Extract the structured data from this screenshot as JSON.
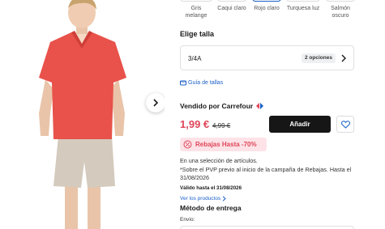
{
  "colors": {
    "accent": "#1a5fc7",
    "price": "#e0455a",
    "sale_bg": "#fde3e7",
    "button": "#161616",
    "shirt": "#e8524a",
    "shorts": "#d4cabd"
  },
  "swatches": [
    {
      "label": "Gris melange",
      "selected": false
    },
    {
      "label": "Caqui claro",
      "selected": false
    },
    {
      "label": "Rojo claro",
      "selected": true
    },
    {
      "label": "Turquesa luz",
      "selected": false
    },
    {
      "label": "Salmón oscuro",
      "selected": false
    }
  ],
  "size": {
    "title": "Elige talla",
    "value": "3/4A",
    "options_badge": "2 opciones"
  },
  "size_guide": "Guía de tallas",
  "seller": "Vendido por Carrefour",
  "price": {
    "current": "1,99 €",
    "old": "4,99 €"
  },
  "add_label": "Añadir",
  "sale_badge": "Rebajas Hasta -70%",
  "promo": {
    "line1": "En una selección de artículos.",
    "line2": "*Sobre el PVP previo al inicio de la campaña de Rebajas. Hasta el 31/08/2026",
    "valid": "Válido hasta el 31/08/2026",
    "products_link": "Ver los productos"
  },
  "delivery": {
    "title": "Método de entrega",
    "shipping_label": "Envío:"
  },
  "icons": {
    "next": "chevron-right-icon",
    "size_chevron": "chevron-right-icon",
    "guide": "ruler-icon",
    "seller_logo": "carrefour-logo",
    "favorite": "heart-icon",
    "sale": "discount-icon"
  }
}
